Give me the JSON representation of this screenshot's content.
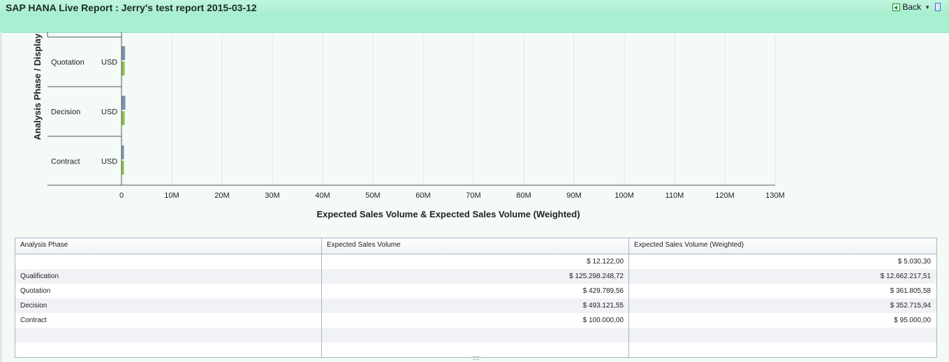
{
  "header": {
    "title": "SAP HANA Live Report : Jerry's test report 2015-03-12",
    "back_label": "Back"
  },
  "icons": {
    "back": "back-arrow-icon",
    "dropdown": "chevron-down-icon",
    "corner": "window-icon"
  },
  "colors": {
    "header_bg": "#a8f0d2",
    "series_volume": "#7f8fb0",
    "series_weighted": "#8cc04a",
    "gridline": "#dbe6f5"
  },
  "chart_data": {
    "type": "bar",
    "orientation": "horizontal",
    "ylabel": "Analysis Phase / Display",
    "xlabel": "Expected Sales Volume & Expected Sales Volume (Weighted)",
    "categories": [
      "Quotation",
      "Decision",
      "Contract"
    ],
    "currency_labels": [
      "USD",
      "USD",
      "USD"
    ],
    "x_ticks": [
      "0",
      "10M",
      "20M",
      "30M",
      "40M",
      "50M",
      "60M",
      "70M",
      "80M",
      "90M",
      "100M",
      "110M",
      "120M",
      "130M"
    ],
    "xlim": [
      0,
      130000000
    ],
    "series": [
      {
        "name": "Expected Sales Volume",
        "values": [
          429789.56,
          493121.55,
          100000.0
        ]
      },
      {
        "name": "Expected Sales Volume (Weighted)",
        "values": [
          361805.58,
          352715.94,
          95000.0
        ]
      }
    ],
    "grid": true
  },
  "table": {
    "columns": [
      "Analysis Phase",
      "Expected Sales Volume",
      "Expected Sales Volume (Weighted)"
    ],
    "rows": [
      {
        "phase": "",
        "volume": "$ 12.122,00",
        "weighted": "$ 5.030,30"
      },
      {
        "phase": "Qualification",
        "volume": "$ 125.298.248,72",
        "weighted": "$ 12.662.217,51"
      },
      {
        "phase": "Quotation",
        "volume": "$ 429.789,56",
        "weighted": "$ 361.805,58"
      },
      {
        "phase": "Decision",
        "volume": "$ 493.121,55",
        "weighted": "$ 352.715,94"
      },
      {
        "phase": "Contract",
        "volume": "$ 100.000,00",
        "weighted": "$ 95.000,00"
      }
    ]
  }
}
